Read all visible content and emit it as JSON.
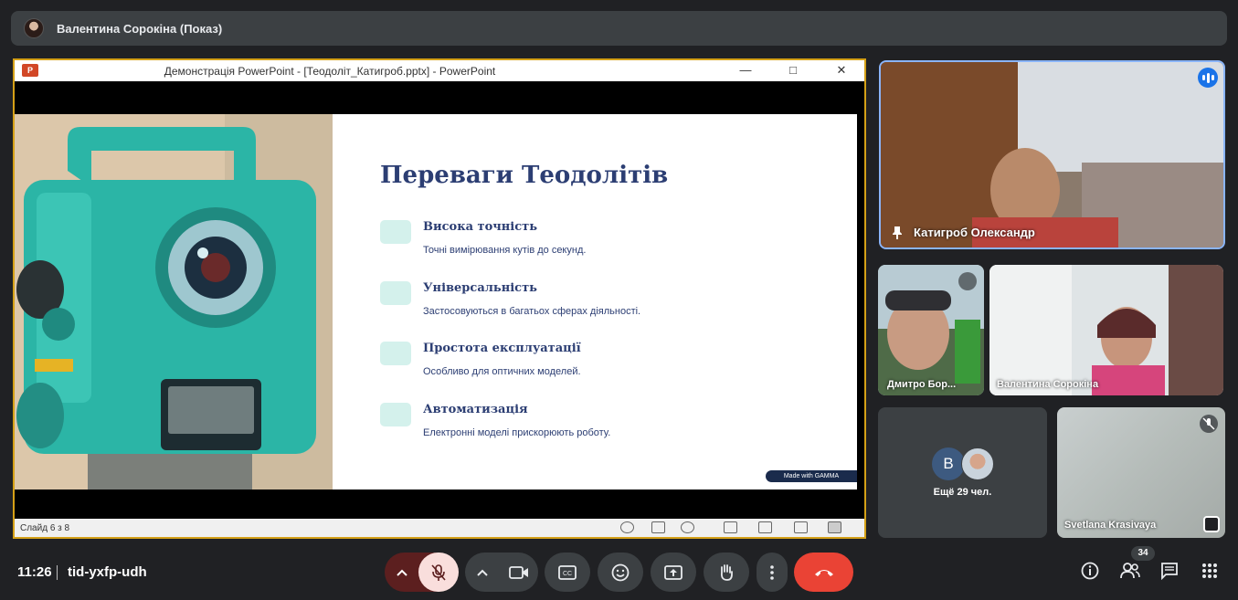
{
  "presenter_bar": {
    "title": "Валентина Сорокіна (Показ)"
  },
  "powerpoint": {
    "window_title": "Демонстрація PowerPoint - [Теодоліт_Катигроб.pptx] - PowerPoint",
    "logo_text": "P",
    "status_text": "Слайд 6 з 8",
    "slide": {
      "heading": "Переваги Теодолітів",
      "features": [
        {
          "title": "Висока точність",
          "desc": "Точні вимірювання кутів до секунд."
        },
        {
          "title": "Універсальність",
          "desc": "Застосовуються в багатьох сферах діяльності."
        },
        {
          "title": "Простота експлуатації",
          "desc": "Особливо для оптичних моделей."
        },
        {
          "title": "Автоматизація",
          "desc": "Електронні моделі прискорюють роботу."
        }
      ],
      "badge": "Made with GAMMA"
    }
  },
  "participants": {
    "main": {
      "name": "Катигроб Олександр"
    },
    "dmytro": {
      "name": "Дмитро Бор..."
    },
    "valentyna": {
      "name": "Валентина Сорокіна"
    },
    "more": {
      "avatar_letter": "В",
      "label": "Ещё 29 чел."
    },
    "svetlana": {
      "name": "Svetlana Krasivaya"
    }
  },
  "bottom": {
    "time": "11:26",
    "meeting_code": "tid-yxfp-udh",
    "participant_count": "34"
  },
  "colors": {
    "accent": "#8ab4f8",
    "end_call": "#ea4335",
    "slide_heading": "#2c3e73",
    "feature_box": "#d4f1ec",
    "device_teal": "#2bb5a6"
  }
}
